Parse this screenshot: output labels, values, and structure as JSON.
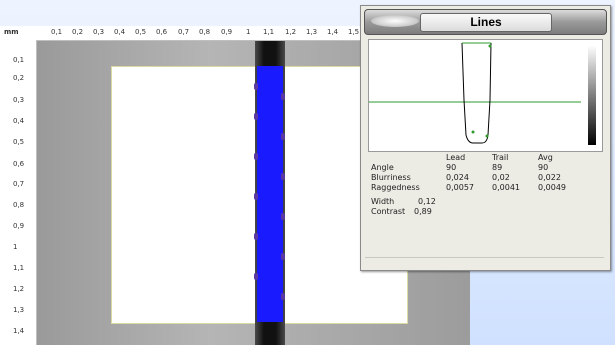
{
  "ruler": {
    "unit": "mm",
    "top_ticks": [
      "0,1",
      "0,2",
      "0,3",
      "0,4",
      "0,5",
      "0,6",
      "0,7",
      "0,8",
      "0,9",
      "1",
      "1,1",
      "1,2",
      "1,3",
      "1,4",
      "1,5"
    ],
    "left_ticks": [
      "0,1",
      "0,2",
      "0,3",
      "0,4",
      "0,5",
      "0,6",
      "0,7",
      "0,8",
      "0,9",
      "1",
      "1,1",
      "1,2",
      "1,3",
      "1,4"
    ]
  },
  "lines_window": {
    "title": "Lines",
    "headers": {
      "lead": "Lead",
      "trail": "Trail",
      "avg": "Avg"
    },
    "rows": [
      {
        "label": "Angle",
        "lead": "90",
        "trail": "89",
        "avg": "90"
      },
      {
        "label": "Blurriness",
        "lead": "0,024",
        "trail": "0,02",
        "avg": "0,022"
      },
      {
        "label": "Raggedness",
        "lead": "0,0057",
        "trail": "0,0041",
        "avg": "0,0049"
      }
    ],
    "width_label": "Width",
    "width_value": "0,12",
    "contrast_label": "Contrast",
    "contrast_value": "0,89"
  },
  "colors": {
    "line_fill": "#1a1aff",
    "profile_curve": "#000000",
    "threshold_line": "#2e9a2e"
  }
}
